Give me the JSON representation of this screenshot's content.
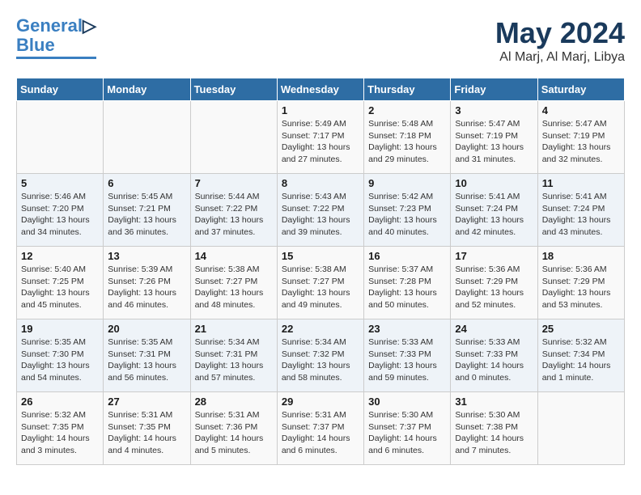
{
  "logo": {
    "line1": "General",
    "line2": "Blue"
  },
  "title": "May 2024",
  "location": "Al Marj, Al Marj, Libya",
  "headers": [
    "Sunday",
    "Monday",
    "Tuesday",
    "Wednesday",
    "Thursday",
    "Friday",
    "Saturday"
  ],
  "weeks": [
    [
      {
        "day": "",
        "info": ""
      },
      {
        "day": "",
        "info": ""
      },
      {
        "day": "",
        "info": ""
      },
      {
        "day": "1",
        "info": "Sunrise: 5:49 AM\nSunset: 7:17 PM\nDaylight: 13 hours\nand 27 minutes."
      },
      {
        "day": "2",
        "info": "Sunrise: 5:48 AM\nSunset: 7:18 PM\nDaylight: 13 hours\nand 29 minutes."
      },
      {
        "day": "3",
        "info": "Sunrise: 5:47 AM\nSunset: 7:19 PM\nDaylight: 13 hours\nand 31 minutes."
      },
      {
        "day": "4",
        "info": "Sunrise: 5:47 AM\nSunset: 7:19 PM\nDaylight: 13 hours\nand 32 minutes."
      }
    ],
    [
      {
        "day": "5",
        "info": "Sunrise: 5:46 AM\nSunset: 7:20 PM\nDaylight: 13 hours\nand 34 minutes."
      },
      {
        "day": "6",
        "info": "Sunrise: 5:45 AM\nSunset: 7:21 PM\nDaylight: 13 hours\nand 36 minutes."
      },
      {
        "day": "7",
        "info": "Sunrise: 5:44 AM\nSunset: 7:22 PM\nDaylight: 13 hours\nand 37 minutes."
      },
      {
        "day": "8",
        "info": "Sunrise: 5:43 AM\nSunset: 7:22 PM\nDaylight: 13 hours\nand 39 minutes."
      },
      {
        "day": "9",
        "info": "Sunrise: 5:42 AM\nSunset: 7:23 PM\nDaylight: 13 hours\nand 40 minutes."
      },
      {
        "day": "10",
        "info": "Sunrise: 5:41 AM\nSunset: 7:24 PM\nDaylight: 13 hours\nand 42 minutes."
      },
      {
        "day": "11",
        "info": "Sunrise: 5:41 AM\nSunset: 7:24 PM\nDaylight: 13 hours\nand 43 minutes."
      }
    ],
    [
      {
        "day": "12",
        "info": "Sunrise: 5:40 AM\nSunset: 7:25 PM\nDaylight: 13 hours\nand 45 minutes."
      },
      {
        "day": "13",
        "info": "Sunrise: 5:39 AM\nSunset: 7:26 PM\nDaylight: 13 hours\nand 46 minutes."
      },
      {
        "day": "14",
        "info": "Sunrise: 5:38 AM\nSunset: 7:27 PM\nDaylight: 13 hours\nand 48 minutes."
      },
      {
        "day": "15",
        "info": "Sunrise: 5:38 AM\nSunset: 7:27 PM\nDaylight: 13 hours\nand 49 minutes."
      },
      {
        "day": "16",
        "info": "Sunrise: 5:37 AM\nSunset: 7:28 PM\nDaylight: 13 hours\nand 50 minutes."
      },
      {
        "day": "17",
        "info": "Sunrise: 5:36 AM\nSunset: 7:29 PM\nDaylight: 13 hours\nand 52 minutes."
      },
      {
        "day": "18",
        "info": "Sunrise: 5:36 AM\nSunset: 7:29 PM\nDaylight: 13 hours\nand 53 minutes."
      }
    ],
    [
      {
        "day": "19",
        "info": "Sunrise: 5:35 AM\nSunset: 7:30 PM\nDaylight: 13 hours\nand 54 minutes."
      },
      {
        "day": "20",
        "info": "Sunrise: 5:35 AM\nSunset: 7:31 PM\nDaylight: 13 hours\nand 56 minutes."
      },
      {
        "day": "21",
        "info": "Sunrise: 5:34 AM\nSunset: 7:31 PM\nDaylight: 13 hours\nand 57 minutes."
      },
      {
        "day": "22",
        "info": "Sunrise: 5:34 AM\nSunset: 7:32 PM\nDaylight: 13 hours\nand 58 minutes."
      },
      {
        "day": "23",
        "info": "Sunrise: 5:33 AM\nSunset: 7:33 PM\nDaylight: 13 hours\nand 59 minutes."
      },
      {
        "day": "24",
        "info": "Sunrise: 5:33 AM\nSunset: 7:33 PM\nDaylight: 14 hours\nand 0 minutes."
      },
      {
        "day": "25",
        "info": "Sunrise: 5:32 AM\nSunset: 7:34 PM\nDaylight: 14 hours\nand 1 minute."
      }
    ],
    [
      {
        "day": "26",
        "info": "Sunrise: 5:32 AM\nSunset: 7:35 PM\nDaylight: 14 hours\nand 3 minutes."
      },
      {
        "day": "27",
        "info": "Sunrise: 5:31 AM\nSunset: 7:35 PM\nDaylight: 14 hours\nand 4 minutes."
      },
      {
        "day": "28",
        "info": "Sunrise: 5:31 AM\nSunset: 7:36 PM\nDaylight: 14 hours\nand 5 minutes."
      },
      {
        "day": "29",
        "info": "Sunrise: 5:31 AM\nSunset: 7:37 PM\nDaylight: 14 hours\nand 6 minutes."
      },
      {
        "day": "30",
        "info": "Sunrise: 5:30 AM\nSunset: 7:37 PM\nDaylight: 14 hours\nand 6 minutes."
      },
      {
        "day": "31",
        "info": "Sunrise: 5:30 AM\nSunset: 7:38 PM\nDaylight: 14 hours\nand 7 minutes."
      },
      {
        "day": "",
        "info": ""
      }
    ]
  ]
}
